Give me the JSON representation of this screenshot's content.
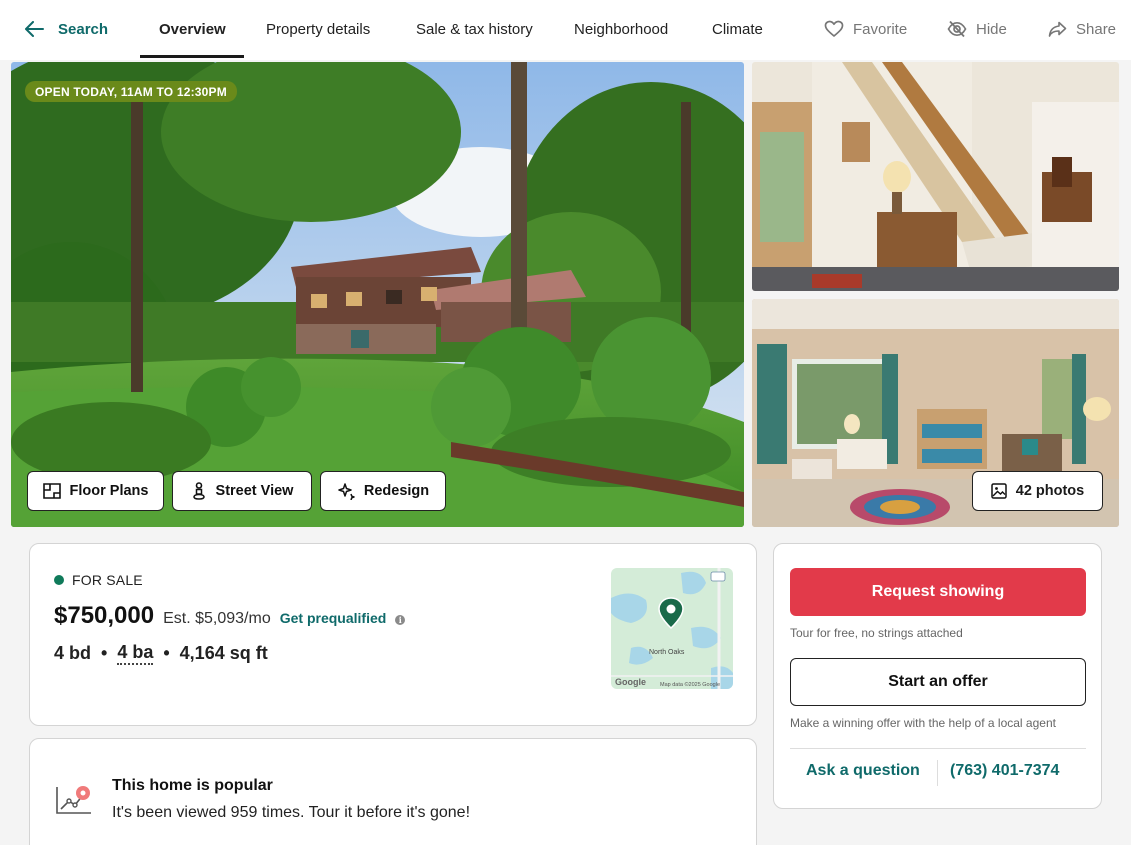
{
  "nav": {
    "back_label": "Search",
    "tabs": [
      "Overview",
      "Property details",
      "Sale & tax history",
      "Neighborhood",
      "Climate"
    ],
    "active_tab": "Overview",
    "actions": {
      "favorite": "Favorite",
      "hide": "Hide",
      "share": "Share"
    }
  },
  "photos": {
    "open_house_badge": "OPEN TODAY, 11AM TO 12:30PM",
    "buttons": {
      "floor_plans": "Floor Plans",
      "street_view": "Street View",
      "redesign": "Redesign"
    },
    "photo_count_label": "42 photos"
  },
  "listing": {
    "status": "FOR SALE",
    "status_color": "#0f7a5a",
    "price": "$750,000",
    "estimate": "Est. $5,093/mo",
    "prequal_link": "Get prequalified",
    "beds": "4 bd",
    "baths": "4 ba",
    "sqft": "4,164 sq ft",
    "map_label": "North Oaks",
    "map_attribution": "Map data ©2025 Google",
    "map_logo": "Google"
  },
  "popular": {
    "title": "This home is popular",
    "text": "It's been viewed 959 times. Tour it before it's gone!"
  },
  "cta": {
    "request_label": "Request showing",
    "request_color": "#e23a4a",
    "request_sub": "Tour for free, no strings attached",
    "offer_label": "Start an offer",
    "offer_sub": "Make a winning offer with the help of a local agent",
    "ask_label": "Ask a question",
    "phone": "(763) 401-7374"
  },
  "colors": {
    "accent_teal": "#0f6a6a"
  }
}
